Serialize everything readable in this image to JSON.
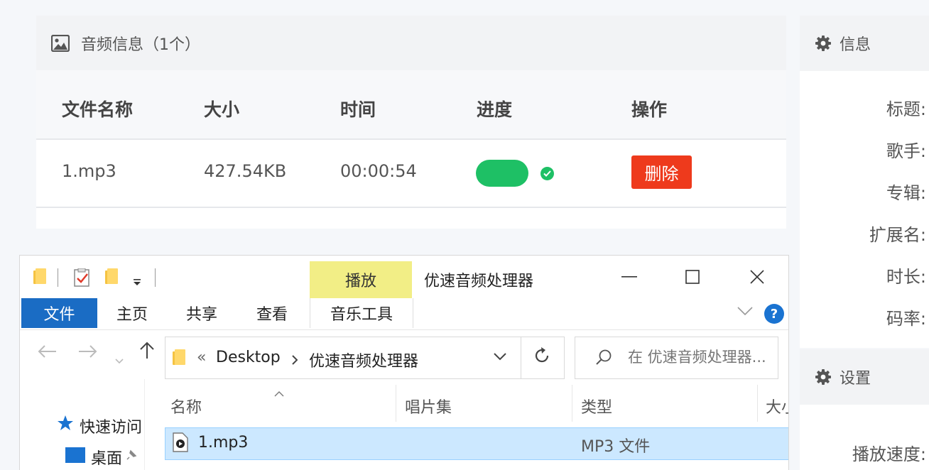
{
  "audio_panel": {
    "title": "音频信息（1个）",
    "icon": "image-icon",
    "columns": [
      "文件名称",
      "大小",
      "时间",
      "进度",
      "操作"
    ],
    "rows": [
      {
        "name": "1.mp3",
        "size": "427.54KB",
        "duration": "00:00:54",
        "progress": 1.0,
        "status_icon": "check-circle-icon",
        "action": "删除"
      }
    ],
    "progress_color": "#1ec065",
    "delete_color": "#ee3a1c"
  },
  "info_sidebar": {
    "title": "信息",
    "fields": [
      "标题:",
      "歌手:",
      "专辑:",
      "扩展名:",
      "时长:",
      "码率:"
    ]
  },
  "settings_sidebar": {
    "title": "设置",
    "fields": [
      "播放速度:"
    ]
  },
  "explorer": {
    "title": "优速音频处理器",
    "context_tab": "播放",
    "context_tab_color": "#f2ee86",
    "ribbon_tabs": [
      "文件",
      "主页",
      "共享",
      "查看",
      "音乐工具"
    ],
    "address": {
      "prefix": "«",
      "parts": [
        "Desktop",
        "优速音频处理器"
      ]
    },
    "search_placeholder": "在 优速音频处理器...",
    "columns": [
      "名称",
      "唱片集",
      "类型",
      "大小"
    ],
    "nav_pane": [
      "快速访问",
      "桌面"
    ],
    "files": [
      {
        "name": "1.mp3",
        "album": "",
        "type": "MP3 文件"
      }
    ],
    "accent": "#1a6cc4"
  }
}
